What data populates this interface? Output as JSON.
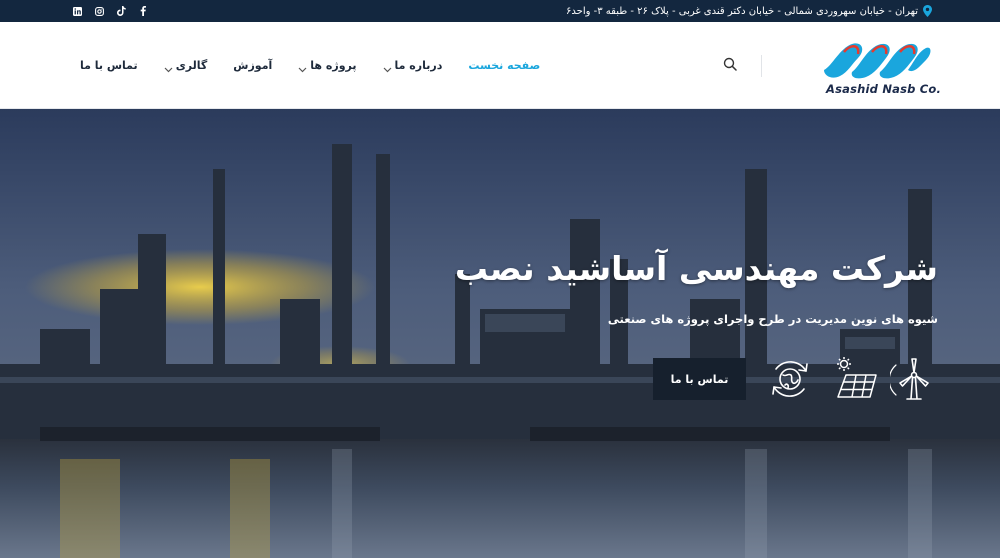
{
  "topbar": {
    "address": "تهران - خیابان سهروردی شمالی - خیابان دکتر قندی غربی - پلاک ۲۶ - طبقه ۳- واحد۶",
    "icons": [
      "location-pin-icon",
      "facebook-icon",
      "tiktok-icon",
      "instagram-icon",
      "linkedin-icon"
    ]
  },
  "header": {
    "logo_text": "Asashid Nasb Co.",
    "nav": [
      {
        "label": "صفحه نخست",
        "active": true,
        "dropdown": false
      },
      {
        "label": "درباره ما",
        "active": false,
        "dropdown": true
      },
      {
        "label": "پروژه ها",
        "active": false,
        "dropdown": true
      },
      {
        "label": "آموزش",
        "active": false,
        "dropdown": false
      },
      {
        "label": "گالری",
        "active": false,
        "dropdown": true
      },
      {
        "label": "تماس با ما",
        "active": false,
        "dropdown": false
      }
    ],
    "icons": [
      "search-icon"
    ]
  },
  "hero": {
    "title": "شرکت مهندسی آساشید نصب",
    "subtitle": "شیوه های نوین مدیریت در طرح واجرای پروژه های صنعتی",
    "cta_label": "تماس با ما",
    "feature_icons": [
      "wind-turbine-icon",
      "solar-panel-icon",
      "eco-recycle-icon"
    ]
  },
  "colors": {
    "topbar_bg": "#13273f",
    "accent": "#1aa6dd",
    "nav_text": "#1e2a3b",
    "cta_bg": "#16202d"
  }
}
